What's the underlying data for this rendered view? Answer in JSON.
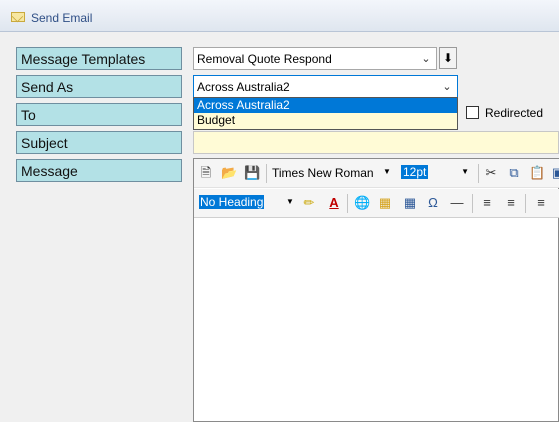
{
  "window": {
    "title": "Send Email"
  },
  "labels": {
    "templates": "Message Templates",
    "send_as": "Send As",
    "to": "To",
    "subject": "Subject",
    "message": "Message"
  },
  "templates": {
    "value": "Removal Quote Respond"
  },
  "send_as": {
    "value": "Across Australia2",
    "options": [
      "Across Australia2",
      "Budget"
    ]
  },
  "redirected": {
    "label": "Redirected",
    "checked": false
  },
  "editor": {
    "font": "Times New Roman",
    "size": "12pt",
    "heading": "No Heading"
  },
  "colors": {
    "label_bg": "#b3e1e6",
    "highlight": "#0078d7",
    "subject_bg": "#fffbd6"
  }
}
